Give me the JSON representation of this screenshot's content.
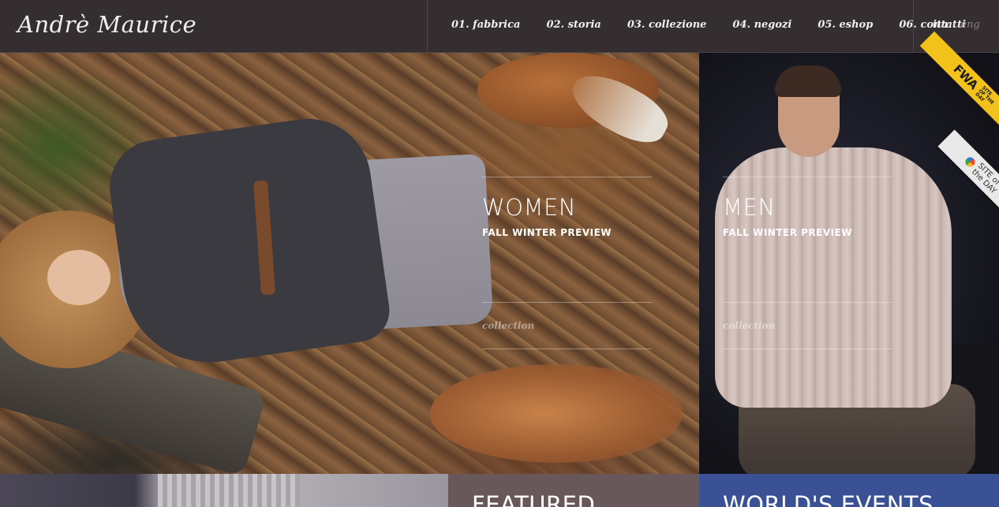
{
  "header": {
    "logo": "Andrè Maurice",
    "nav": [
      {
        "label": "01. fabbrica"
      },
      {
        "label": "02. storia"
      },
      {
        "label": "03. collezione"
      },
      {
        "label": "04. negozi"
      },
      {
        "label": "05. eshop"
      },
      {
        "label": "06. contatti"
      }
    ],
    "languages": {
      "active": "ita",
      "inactive": "eng"
    }
  },
  "panels": {
    "women": {
      "title": "WOMEN",
      "subtitle": "FALL WINTER PREVIEW",
      "link": "collection"
    },
    "men": {
      "title": "MEN",
      "subtitle": "FALL WINTER PREVIEW",
      "link": "collection"
    }
  },
  "ribbons": {
    "fwa": {
      "logo": "FWA",
      "text": "SITE OF THE DAY"
    },
    "site_of_the_day": {
      "line1": "SITE of",
      "line2": "the DAY"
    }
  },
  "tiles": {
    "featured": {
      "title": "FEATURED"
    },
    "events": {
      "title": "WORLD'S EVENTS"
    }
  },
  "colors": {
    "header_bg": "#342e31",
    "featured_bg": "#69585a",
    "events_bg": "#3b5196",
    "ribbon_yellow": "#f2c21a"
  }
}
